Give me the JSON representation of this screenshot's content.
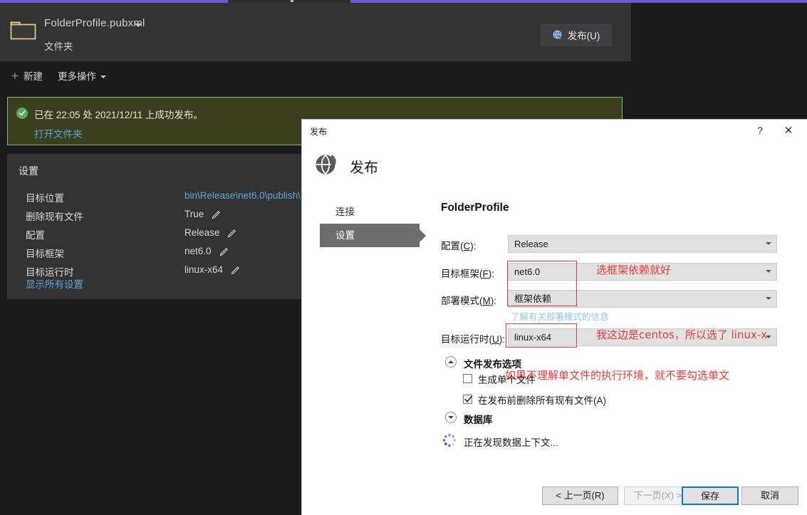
{
  "vs": {
    "profile": {
      "name": "FolderProfile.pubxml",
      "subtitle": "文件夹",
      "publish_button": "发布(U)"
    },
    "toolbar": {
      "new_label": "新建",
      "more_label": "更多操作"
    },
    "banner": {
      "message": "已在 22:05 处 2021/12/11 上成功发布。",
      "link": "打开文件夹"
    },
    "settings": {
      "title": "设置",
      "rows": [
        {
          "label": "目标位置",
          "value": "bin\\Release\\net6.0\\publish\\",
          "kind": "link-copy"
        },
        {
          "label": "删除现有文件",
          "value": "True",
          "kind": "edit"
        },
        {
          "label": "配置",
          "value": "Release",
          "kind": "edit"
        },
        {
          "label": "目标框架",
          "value": "net6.0",
          "kind": "edit"
        },
        {
          "label": "目标运行时",
          "value": "linux-x64",
          "kind": "edit"
        }
      ],
      "show_all": "显示所有设置"
    }
  },
  "dialog": {
    "window_title": "发布",
    "heading": "发布",
    "help_glyph": "?",
    "close_glyph": "✕",
    "nav": [
      {
        "label": "连接",
        "selected": false
      },
      {
        "label": "设置",
        "selected": true
      }
    ],
    "form_title": "FolderProfile",
    "fields": [
      {
        "label_text": "配置(",
        "label_key": "C",
        "label_tail": "):",
        "value": "Release"
      },
      {
        "label_text": "目标框架(",
        "label_key": "F",
        "label_tail": "):",
        "value": "net6.0"
      },
      {
        "label_text": "部署模式(",
        "label_key": "M",
        "label_tail": "):",
        "value": "框架依赖"
      },
      {
        "label_text": "目标运行时(",
        "label_key": "U",
        "label_tail": "):",
        "value": "linux-x64"
      }
    ],
    "deploy_info_link": "了解有关部署模式的信息",
    "file_options": {
      "group_title": "文件发布选项",
      "single_file": {
        "label": "生成单个文件",
        "checked": false
      },
      "delete_existing": {
        "label": "在发布前删除所有现有文件(A)",
        "checked": true
      }
    },
    "database": {
      "group_title": "数据库",
      "status": "正在发现数据上下文..."
    },
    "annotations": [
      {
        "text": "选框架依赖就好"
      },
      {
        "text": "我这边是centos，所以选了 linux-x"
      },
      {
        "text": "如果不理解单文件的执行环境，就不要勾选单文"
      }
    ],
    "buttons": {
      "prev": "< 上一页(R)",
      "next": "下一页(X) >",
      "save": "保存",
      "cancel": "取消"
    }
  },
  "colors": {
    "accent_purple": "#6b57d4",
    "success_green": "#6fbf73",
    "annotation_red": "#ef3a3a",
    "link_blue": "#5ba7d9",
    "focus_blue": "#0078d7"
  }
}
